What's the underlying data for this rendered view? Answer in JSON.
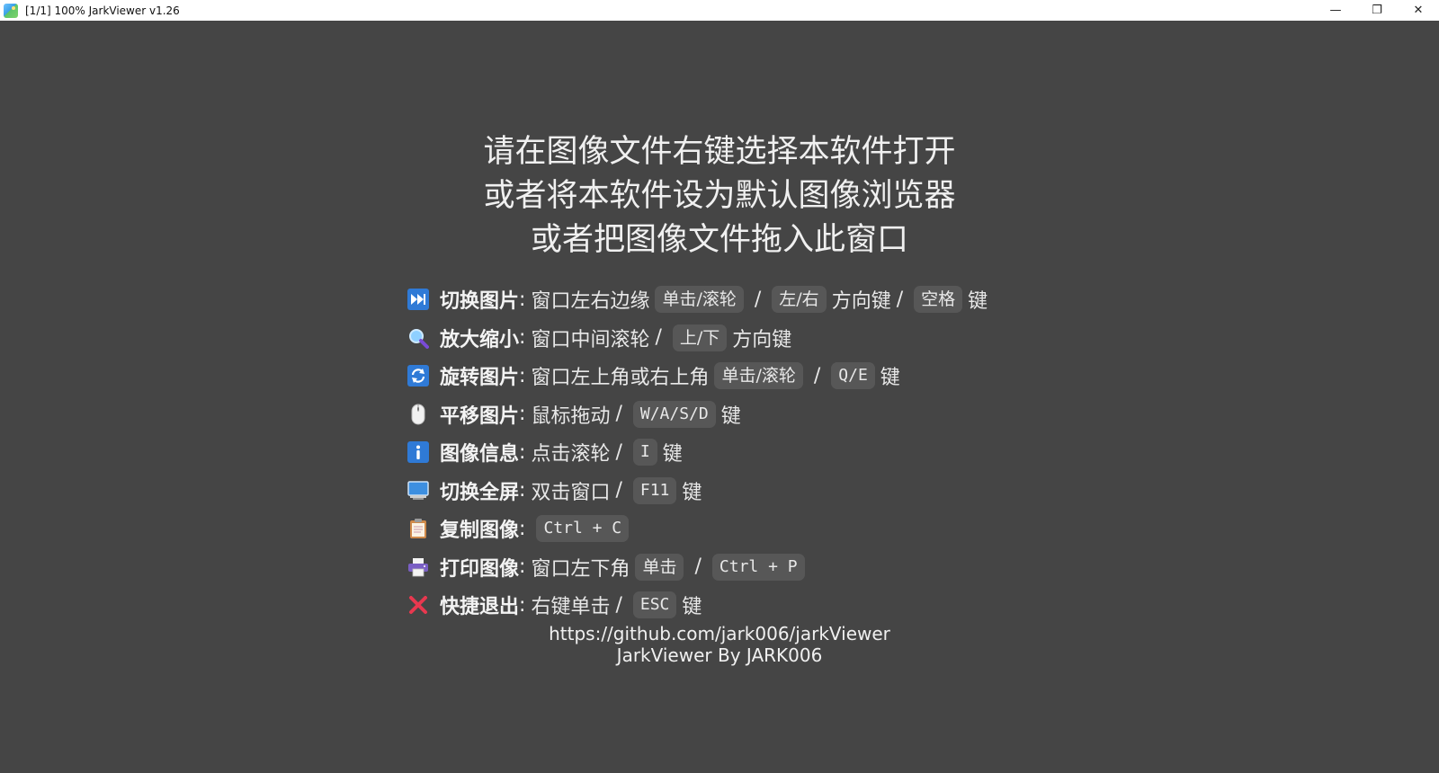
{
  "window": {
    "title": "[1/1] 100% JarkViewer v1.26",
    "minimize_glyph": "—",
    "restore_glyph": "❐",
    "close_glyph": "✕"
  },
  "headline": [
    "请在图像文件右键选择本软件打开",
    "或者将本软件设为默认图像浏览器",
    "或者把图像文件拖入此窗口"
  ],
  "shortcuts": [
    {
      "icon": "next-track-icon",
      "label": "切换图片",
      "desc": "窗口左右边缘",
      "keys": [
        "单击/滚轮",
        "左/右"
      ],
      "after": "方向键",
      "keys2": [
        "空格"
      ],
      "suffix": "键"
    },
    {
      "icon": "magnifier-icon",
      "label": "放大缩小",
      "desc": "窗口中间滚轮",
      "keys": [
        "上/下"
      ],
      "suffix": "方向键"
    },
    {
      "icon": "rotate-icon",
      "label": "旋转图片",
      "desc": "窗口左上角或右上角",
      "keys": [
        "单击/滚轮",
        "Q/E"
      ],
      "suffix": "键"
    },
    {
      "icon": "mouse-icon",
      "label": "平移图片",
      "desc": "鼠标拖动",
      "keys": [
        "W/A/S/D"
      ],
      "suffix": "键"
    },
    {
      "icon": "info-icon",
      "label": "图像信息",
      "desc": "点击滚轮",
      "keys": [
        "I"
      ],
      "suffix": "键"
    },
    {
      "icon": "monitor-icon",
      "label": "切换全屏",
      "desc": "双击窗口",
      "keys": [
        "F11"
      ],
      "suffix": "键"
    },
    {
      "icon": "clipboard-icon",
      "label": "复制图像",
      "desc": "",
      "keys": [
        "Ctrl + C"
      ],
      "suffix": ""
    },
    {
      "icon": "printer-icon",
      "label": "打印图像",
      "desc": "窗口左下角",
      "keys": [
        "单击",
        "Ctrl + P"
      ],
      "suffix": ""
    },
    {
      "icon": "close-x-icon",
      "label": "快捷退出",
      "desc": "右键单击",
      "keys": [
        "ESC"
      ],
      "suffix": "键"
    }
  ],
  "colon": ":",
  "slash": "/",
  "footer": {
    "url": "https://github.com/jark006/jarkViewer",
    "credit": "JarkViewer By JARK006"
  }
}
